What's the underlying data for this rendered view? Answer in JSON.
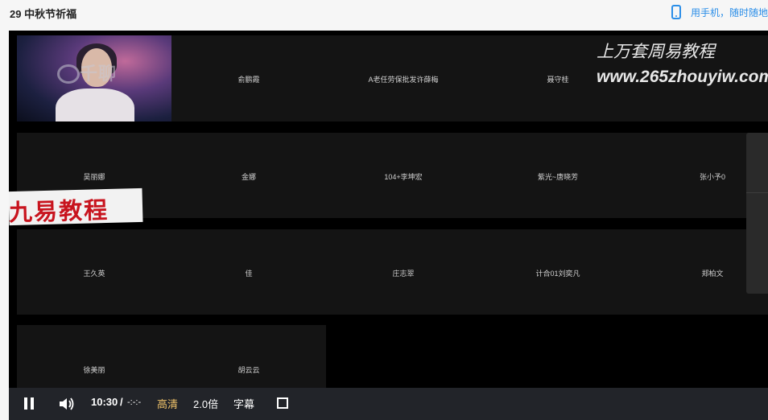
{
  "lesson_title": "29 中秋节祈福",
  "mobile_link": "用手机，随时随地",
  "grid": {
    "row1": [
      "俞鹏霞",
      "A老任劳保批发许薛梅",
      "聂守桂"
    ],
    "row2": [
      "吴丽娜",
      "金娜",
      "104+李坤宏",
      "紫光~唐晓芳",
      "张小予0"
    ],
    "row3": [
      "王久英",
      "佳",
      "庄志翠",
      "计合01刘奕凡",
      "郑柏文"
    ],
    "row4": [
      "徐美丽",
      "胡云云"
    ]
  },
  "watermarks": {
    "cam": "千聊",
    "top_line": "上万套周易教程",
    "url": "www.265zhouyiw.com",
    "banner": "九易教程"
  },
  "controls": {
    "time_current": "10:30",
    "time_separator": "/",
    "time_total": "-:-:-",
    "quality": "高清",
    "speed": "2.0倍",
    "subtitle": "字幕",
    "quality_color": "#f0c36a",
    "icons": [
      "pause-icon",
      "volume-icon",
      "fullscreen-icon"
    ]
  },
  "colors": {
    "link": "#2b8ee8",
    "player_bg": "#000000",
    "tile_bg": "#141414",
    "control_bar": "#222429"
  }
}
